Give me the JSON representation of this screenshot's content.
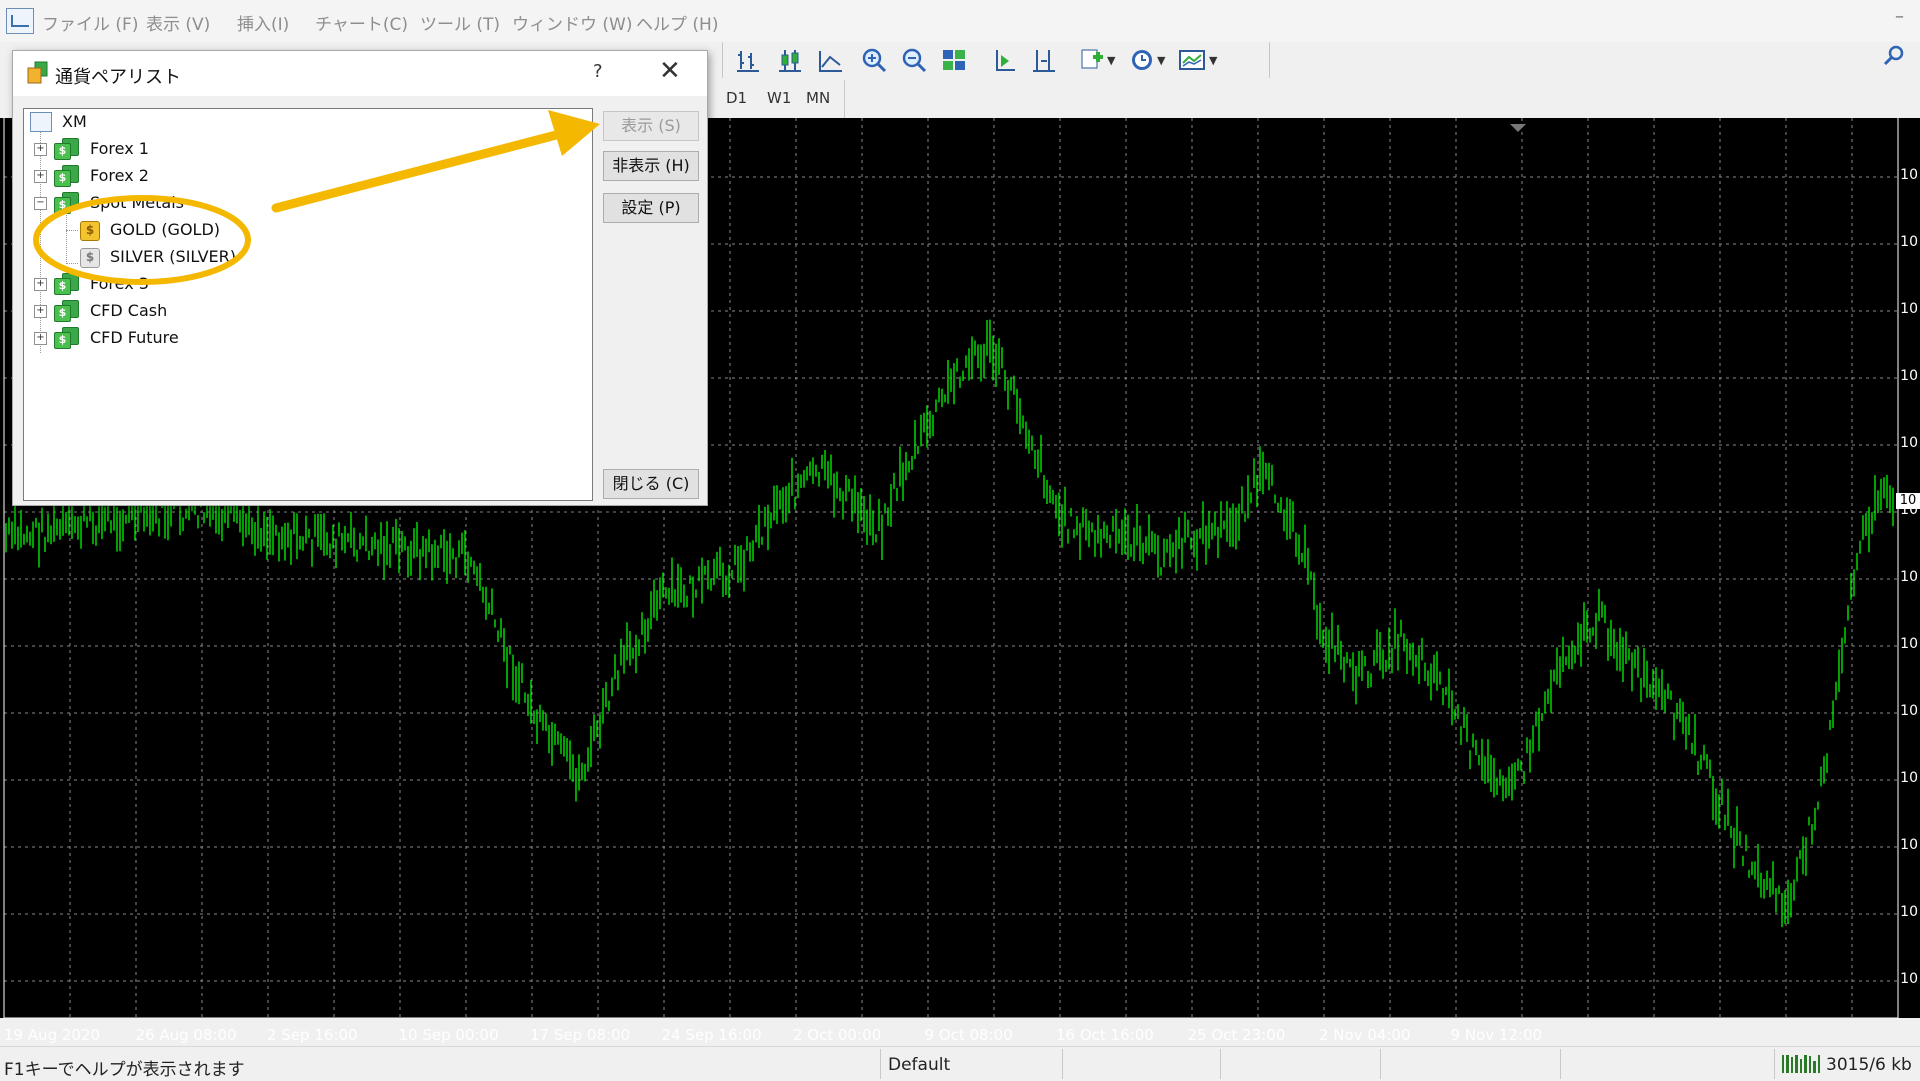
{
  "menu": {
    "items": [
      "ファイル (F)",
      "表示 (V)",
      "挿入(I)",
      "チャート(C)",
      "ツール (T)",
      "ウィンドウ (W)",
      "ヘルプ (H)"
    ],
    "minimize": "–"
  },
  "timeframes": [
    "D1",
    "W1",
    "MN"
  ],
  "dialog": {
    "title": "通貨ペアリスト",
    "help": "?",
    "close": "✕",
    "tree": {
      "root": "XM",
      "groups": [
        "Forex 1",
        "Forex 2",
        "Spot Metals",
        "Forex 3",
        "CFD Cash",
        "CFD Future"
      ],
      "spot_metals_children": [
        "GOLD  (GOLD)",
        "SILVER  (SILVER)"
      ]
    },
    "buttons": {
      "show": "表示 (S)",
      "hide": "非表示 (H)",
      "settings": "設定 (P)",
      "close": "閉じる (C)"
    }
  },
  "chart_data": {
    "type": "line",
    "x_labels": [
      "19 Aug 2020",
      "26 Aug 08:00",
      "2 Sep 16:00",
      "10 Sep 00:00",
      "17 Sep 08:00",
      "24 Sep 16:00",
      "2 Oct 00:00",
      "9 Oct 08:00",
      "16 Oct 16:00",
      "25 Oct 23:00",
      "2 Nov 04:00",
      "9 Nov 12:00"
    ],
    "y_tick_label": "10",
    "current_price_label": "10",
    "series_color": "#00e600",
    "grid": true,
    "background": "#000000"
  },
  "status": {
    "help": "F1キーでヘルプが表示されます",
    "profile": "Default",
    "traffic": "3015/6 kb"
  },
  "colors": {
    "annotation": "#f5b800",
    "candle": "#00e600"
  }
}
